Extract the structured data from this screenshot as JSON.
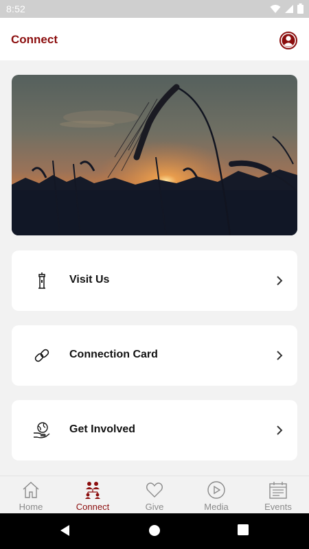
{
  "status_bar": {
    "time": "8:52"
  },
  "app_bar": {
    "title": "Connect"
  },
  "cards": [
    {
      "label": "Visit Us",
      "icon": "lighthouse-icon"
    },
    {
      "label": "Connection Card",
      "icon": "link-icon"
    },
    {
      "label": "Get Involved",
      "icon": "globe-hand-icon"
    }
  ],
  "tabs": [
    {
      "label": "Home",
      "icon": "home-icon",
      "active": false
    },
    {
      "label": "Connect",
      "icon": "people-icon",
      "active": true
    },
    {
      "label": "Give",
      "icon": "heart-icon",
      "active": false
    },
    {
      "label": "Media",
      "icon": "play-circle-icon",
      "active": false
    },
    {
      "label": "Events",
      "icon": "calendar-icon",
      "active": false
    }
  ],
  "colors": {
    "brand": "#8b0d0d",
    "inactive": "#8a8a8a",
    "background": "#f2f2f2"
  }
}
